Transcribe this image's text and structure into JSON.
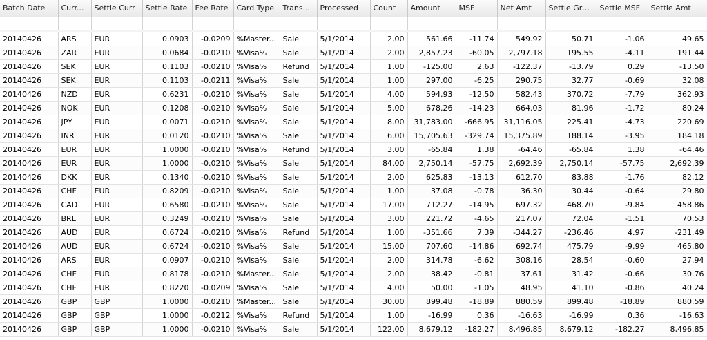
{
  "columns": [
    "Batch Date",
    "Curr...",
    "Settle Curr",
    "Settle Rate",
    "Fee Rate",
    "Card Type",
    "Trans...",
    "Processed",
    "Count",
    "Amount",
    "MSF",
    "Net Amt",
    "Settle Gross",
    "Settle MSF",
    "Settle Amt"
  ],
  "rows": [
    [
      "20140426",
      "ARS",
      "EUR",
      "0.0903",
      "-0.0209",
      "%Master...",
      "Sale",
      "5/1/2014",
      "2.00",
      "561.66",
      "-11.74",
      "549.92",
      "50.71",
      "-1.06",
      "49.65"
    ],
    [
      "20140426",
      "ZAR",
      "EUR",
      "0.0684",
      "-0.0210",
      "%Visa%",
      "Sale",
      "5/1/2014",
      "2.00",
      "2,857.23",
      "-60.05",
      "2,797.18",
      "195.55",
      "-4.11",
      "191.44"
    ],
    [
      "20140426",
      "SEK",
      "EUR",
      "0.1103",
      "-0.0210",
      "%Visa%",
      "Refund",
      "5/1/2014",
      "1.00",
      "-125.00",
      "2.63",
      "-122.37",
      "-13.79",
      "0.29",
      "-13.50"
    ],
    [
      "20140426",
      "SEK",
      "EUR",
      "0.1103",
      "-0.0211",
      "%Visa%",
      "Sale",
      "5/1/2014",
      "1.00",
      "297.00",
      "-6.25",
      "290.75",
      "32.77",
      "-0.69",
      "32.08"
    ],
    [
      "20140426",
      "NZD",
      "EUR",
      "0.6231",
      "-0.0210",
      "%Visa%",
      "Sale",
      "5/1/2014",
      "4.00",
      "594.93",
      "-12.50",
      "582.43",
      "370.72",
      "-7.79",
      "362.93"
    ],
    [
      "20140426",
      "NOK",
      "EUR",
      "0.1208",
      "-0.0210",
      "%Visa%",
      "Sale",
      "5/1/2014",
      "5.00",
      "678.26",
      "-14.23",
      "664.03",
      "81.96",
      "-1.72",
      "80.24"
    ],
    [
      "20140426",
      "JPY",
      "EUR",
      "0.0071",
      "-0.0210",
      "%Visa%",
      "Sale",
      "5/1/2014",
      "8.00",
      "31,783.00",
      "-666.95",
      "31,116.05",
      "225.41",
      "-4.73",
      "220.69"
    ],
    [
      "20140426",
      "INR",
      "EUR",
      "0.0120",
      "-0.0210",
      "%Visa%",
      "Sale",
      "5/1/2014",
      "6.00",
      "15,705.63",
      "-329.74",
      "15,375.89",
      "188.14",
      "-3.95",
      "184.18"
    ],
    [
      "20140426",
      "EUR",
      "EUR",
      "1.0000",
      "-0.0210",
      "%Visa%",
      "Refund",
      "5/1/2014",
      "3.00",
      "-65.84",
      "1.38",
      "-64.46",
      "-65.84",
      "1.38",
      "-64.46"
    ],
    [
      "20140426",
      "EUR",
      "EUR",
      "1.0000",
      "-0.0210",
      "%Visa%",
      "Sale",
      "5/1/2014",
      "84.00",
      "2,750.14",
      "-57.75",
      "2,692.39",
      "2,750.14",
      "-57.75",
      "2,692.39"
    ],
    [
      "20140426",
      "DKK",
      "EUR",
      "0.1340",
      "-0.0210",
      "%Visa%",
      "Sale",
      "5/1/2014",
      "2.00",
      "625.83",
      "-13.13",
      "612.70",
      "83.88",
      "-1.76",
      "82.12"
    ],
    [
      "20140426",
      "CHF",
      "EUR",
      "0.8209",
      "-0.0210",
      "%Visa%",
      "Sale",
      "5/1/2014",
      "1.00",
      "37.08",
      "-0.78",
      "36.30",
      "30.44",
      "-0.64",
      "29.80"
    ],
    [
      "20140426",
      "CAD",
      "EUR",
      "0.6580",
      "-0.0210",
      "%Visa%",
      "Sale",
      "5/1/2014",
      "17.00",
      "712.27",
      "-14.95",
      "697.32",
      "468.70",
      "-9.84",
      "458.86"
    ],
    [
      "20140426",
      "BRL",
      "EUR",
      "0.3249",
      "-0.0210",
      "%Visa%",
      "Sale",
      "5/1/2014",
      "3.00",
      "221.72",
      "-4.65",
      "217.07",
      "72.04",
      "-1.51",
      "70.53"
    ],
    [
      "20140426",
      "AUD",
      "EUR",
      "0.6724",
      "-0.0210",
      "%Visa%",
      "Refund",
      "5/1/2014",
      "1.00",
      "-351.66",
      "7.39",
      "-344.27",
      "-236.46",
      "4.97",
      "-231.49"
    ],
    [
      "20140426",
      "AUD",
      "EUR",
      "0.6724",
      "-0.0210",
      "%Visa%",
      "Sale",
      "5/1/2014",
      "15.00",
      "707.60",
      "-14.86",
      "692.74",
      "475.79",
      "-9.99",
      "465.80"
    ],
    [
      "20140426",
      "ARS",
      "EUR",
      "0.0907",
      "-0.0210",
      "%Visa%",
      "Sale",
      "5/1/2014",
      "2.00",
      "314.78",
      "-6.62",
      "308.16",
      "28.54",
      "-0.60",
      "27.94"
    ],
    [
      "20140426",
      "CHF",
      "EUR",
      "0.8178",
      "-0.0210",
      "%Master...",
      "Sale",
      "5/1/2014",
      "2.00",
      "38.42",
      "-0.81",
      "37.61",
      "31.42",
      "-0.66",
      "30.76"
    ],
    [
      "20140426",
      "CHF",
      "EUR",
      "0.8220",
      "-0.0209",
      "%Visa%",
      "Sale",
      "5/1/2014",
      "4.00",
      "50.00",
      "-1.05",
      "48.95",
      "41.10",
      "-0.86",
      "40.24"
    ],
    [
      "20140426",
      "GBP",
      "GBP",
      "1.0000",
      "-0.0210",
      "%Master...",
      "Sale",
      "5/1/2014",
      "30.00",
      "899.48",
      "-18.89",
      "880.59",
      "899.48",
      "-18.89",
      "880.59"
    ],
    [
      "20140426",
      "GBP",
      "GBP",
      "1.0000",
      "-0.0212",
      "%Visa%",
      "Refund",
      "5/1/2014",
      "1.00",
      "-16.99",
      "0.36",
      "-16.63",
      "-16.99",
      "0.36",
      "-16.63"
    ],
    [
      "20140426",
      "GBP",
      "GBP",
      "1.0000",
      "-0.0210",
      "%Visa%",
      "Sale",
      "5/1/2014",
      "122.00",
      "8,679.12",
      "-182.27",
      "8,496.85",
      "8,679.12",
      "-182.27",
      "8,496.85"
    ]
  ]
}
